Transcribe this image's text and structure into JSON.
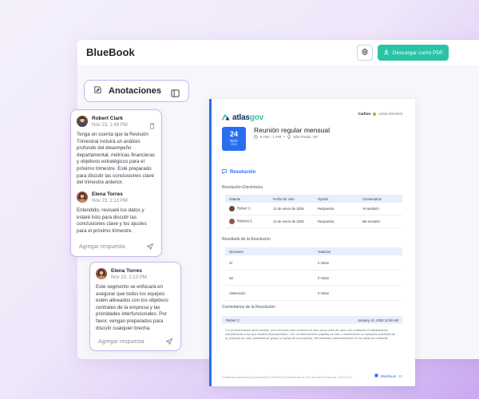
{
  "app": {
    "title": "BlueBook",
    "download_label": "Descargar como PDF"
  },
  "annotations": {
    "title": "Anotaciones",
    "thread1": {
      "first": {
        "author": "Robert Clark",
        "date": "Nov 23, 1:48 PM",
        "text": "Tenga en cuenta que la Revisión Trimestral incluirá un análisis profundo del desempeño departamental, métricas financieras y objetivos estratégicos para el próximo trimestre. Esté preparado para discutir las conclusiones clave del trimestre anterior."
      },
      "reply": {
        "author": "Elena Torres",
        "date": "Nov 23, 2:13 PM",
        "text": "Entendido, revisaré los datos y estaré listo para discutir las conclusiones clave y los ajustes para el próximo trimestre."
      },
      "reply_placeholder": "Agregar respuesta"
    },
    "thread2": {
      "first": {
        "author": "Elena Torres",
        "date": "Nov 23, 2:13 PM",
        "text": "Este segmento se enfocará en asegurar que todos los equipos estén alineados con los objetivos centrales de la empresa y las prioridades interfuncionales. Por favor, vengan preparados para discutir cualquier brecha."
      },
      "reply_placeholder": "Agregar respuesta"
    }
  },
  "document": {
    "logo_main": "atlas",
    "logo_accent": "gov",
    "org": "Carlton",
    "board": "Junta Directiva",
    "date": {
      "day": "24",
      "month": "NOV",
      "year": "2024"
    },
    "meeting_title": "Reunión regular mensual",
    "time": "9 AM - 1 PM",
    "location": "São Paulo, SP",
    "section": "Resolución",
    "vote_title": "Resolución Electrónica",
    "vote_headers": [
      "Votante",
      "Fecha de voto",
      "Opción",
      "Comentarios"
    ],
    "vote_rows": [
      [
        "Robert C.",
        "12 de enero de 2025",
        "Respuesta",
        "Yo también"
      ],
      [
        "Roberto C.",
        "12 de enero de 2025",
        "Respuesta",
        "Me encantó"
      ]
    ],
    "result_title": "Resultado de la Resolución",
    "result_headers": [
      "Opciones",
      "Votación"
    ],
    "result_rows": [
      [
        "Sí",
        "2 Votos"
      ],
      [
        "No",
        "0 Votos"
      ],
      [
        "Abstención",
        "0 Votos"
      ]
    ],
    "comments_title": "Comentarios de la Resolución",
    "comment_author": "Robert C.",
    "comment_date": "January 12, 2025 11:58 AM",
    "comment_text": "\"La recomendación tiene sentido, pero necesito más contexto en una nueva línea de valor con confianza. El alineamiento considerando a los que hubiera desempeñado. Con consideraciones (capital) es más, o incrementar su valuación (cantidad de ej. (estado) de valor (cantidad de grupo) y equipo de la empresa). Me interesan particularmente en las ideas de rediscutir.\"",
    "footer_text": "Confidential prepared by and exclusively for the Board of Directors and is not to be shared for any use - 2024 & Oct",
    "footer_brand": "BlueBook",
    "page": "22"
  },
  "colors": {
    "accent": "#2a6ef0",
    "teal": "#2bc3a4",
    "purple_border": "#c9b3f0"
  }
}
